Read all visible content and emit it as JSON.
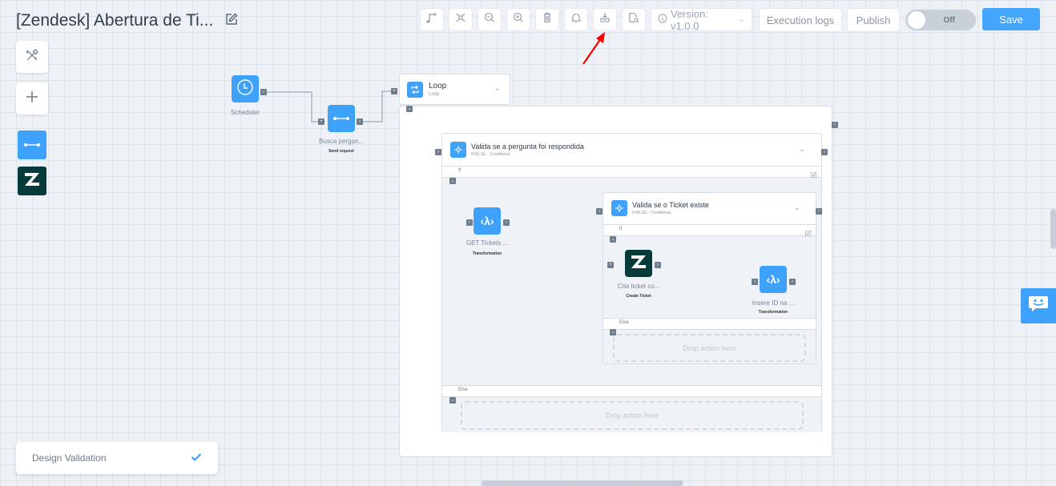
{
  "header": {
    "title": "[Zendesk] Abertura de Ti...",
    "edit_icon": "pencil-square-icon"
  },
  "toolbar": {
    "buttons": [
      {
        "name": "connector-style",
        "icon": "route-icon"
      },
      {
        "name": "fit-screen",
        "icon": "compress-icon"
      },
      {
        "name": "zoom-out",
        "icon": "zoom-out-icon"
      },
      {
        "name": "zoom-in",
        "icon": "zoom-in-icon"
      },
      {
        "name": "delete",
        "icon": "trash-icon"
      },
      {
        "name": "notifications",
        "icon": "bell-icon"
      },
      {
        "name": "export",
        "icon": "download-tray-icon"
      },
      {
        "name": "preview",
        "icon": "file-search-icon"
      }
    ],
    "version_label": "Version: v1.0.0",
    "execution_logs_label": "Execution logs",
    "publish_label": "Publish",
    "toggle_label": "Off",
    "toggle_state": false,
    "save_label": "Save"
  },
  "sidebar": {
    "tools_icon": "tools-icon",
    "add_icon": "plus-icon",
    "tiles": [
      {
        "name": "send-request",
        "icon": "connector-line-icon",
        "color": "#3ea2fb"
      },
      {
        "name": "zendesk",
        "icon": "zendesk-logo-icon",
        "color": "#073b3a"
      }
    ]
  },
  "flow": {
    "scheduler": {
      "label": "Scheduler"
    },
    "busca": {
      "label": "Busca pergun...",
      "sub": "Send request"
    },
    "loop": {
      "title": "Loop",
      "sub": "Loop"
    },
    "cond1": {
      "title": "Valida se a pergunta foi respondida",
      "sub": "IF/ELSE - Conditional",
      "if_label": "If",
      "else_label": "Else",
      "else_drop": "Drop action here"
    },
    "get_tickets": {
      "label": "GET Tickets ...",
      "sub": "Transformation"
    },
    "cond2": {
      "title": "Valida se o Ticket existe",
      "sub": "IF/ELSE - Conditional",
      "if_label": "If",
      "else_label": "Else",
      "else_drop": "Drop action here"
    },
    "cria_ticket": {
      "label": "Cria ticket co...",
      "sub": "Create Ticket"
    },
    "insere_id": {
      "label": "Insere ID na ...",
      "sub": "Transformation"
    }
  },
  "design_validation": {
    "label": "Design Validation",
    "status": "valid"
  },
  "colors": {
    "accent": "#43a5fb",
    "zendesk": "#073b3a",
    "annotation_arrow": "#ff0000"
  }
}
